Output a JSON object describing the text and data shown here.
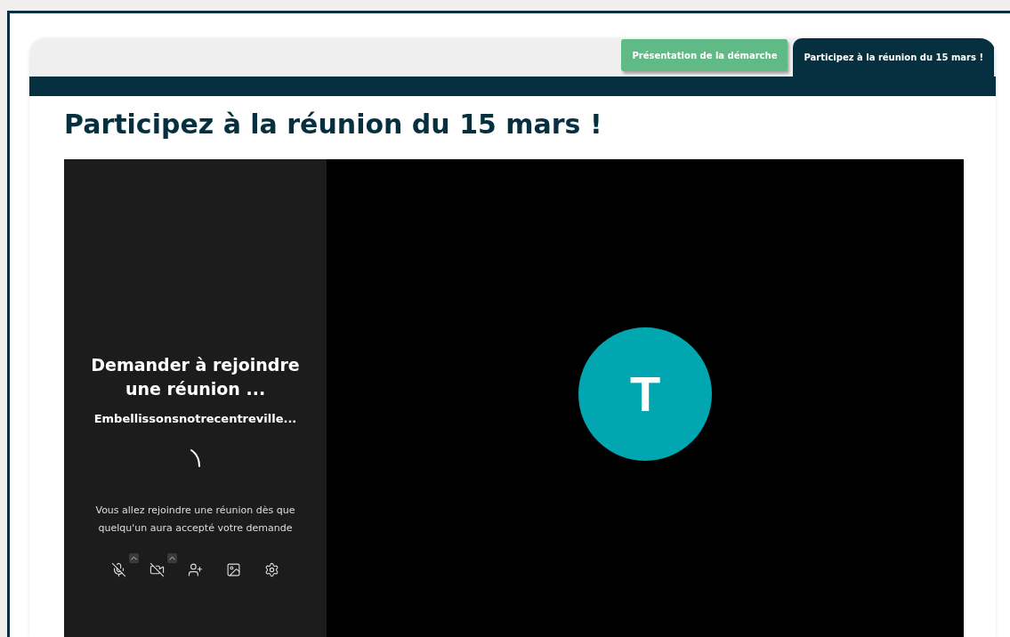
{
  "tabs": [
    {
      "label": "Présentation de la démarche",
      "selected": false
    },
    {
      "label": "Participez à la réunion du 15 mars !",
      "selected": true
    }
  ],
  "title": "Participez à la réunion du 15 mars !",
  "meeting": {
    "heading": "Demander à rejoindre une réunion ...",
    "name": "Embellissonsnotrecentreville...",
    "message": "Vous allez rejoindre une réunion dès que quelqu'un aura accepté votre demande",
    "controls": [
      {
        "kind": "mic",
        "off": true,
        "menu": true
      },
      {
        "kind": "camera",
        "off": true,
        "menu": true
      },
      {
        "kind": "invite"
      },
      {
        "kind": "background"
      },
      {
        "kind": "settings"
      }
    ],
    "avatar": {
      "initial": "T",
      "color": "#00a6b0"
    }
  }
}
